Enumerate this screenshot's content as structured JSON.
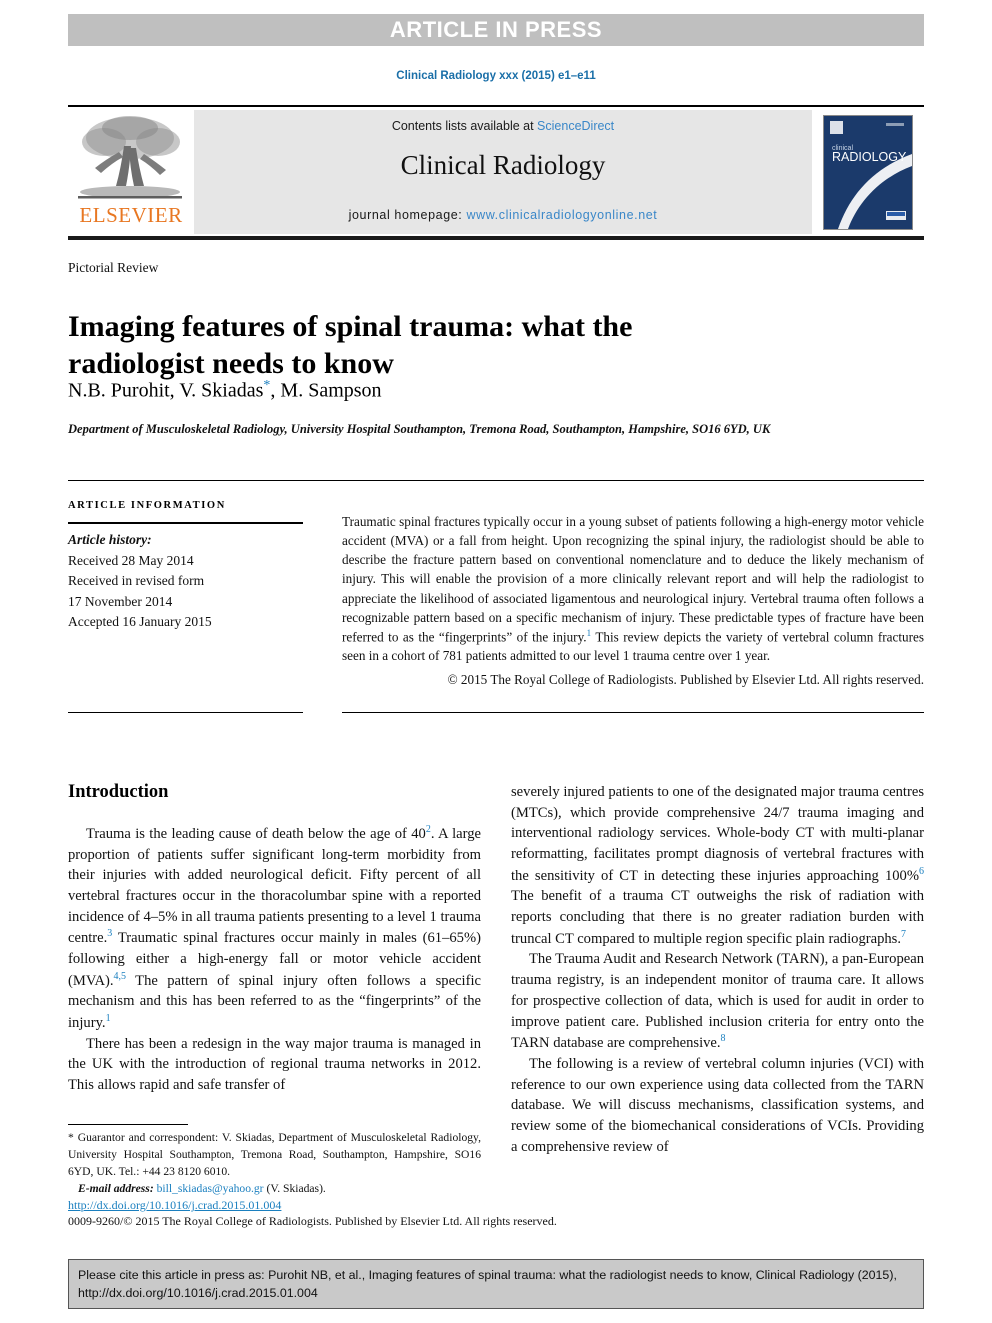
{
  "banner": {
    "text": "ARTICLE IN PRESS"
  },
  "running_head": {
    "text": "Clinical Radiology xxx (2015) e1–e11"
  },
  "masthead": {
    "publisher_logo_label": "ELSEVIER",
    "contents_prefix": "Contents lists available at ",
    "contents_link": "ScienceDirect",
    "journal_name": "Clinical Radiology",
    "homepage_prefix": "journal homepage: ",
    "homepage_link": "www.clinicalradiologyonline.net",
    "cover_line1": "clinical",
    "cover_line2": "RADIOLOGY"
  },
  "article": {
    "type": "Pictorial Review",
    "title": "Imaging features of spinal trauma: what the radiologist needs to know",
    "authors_part1": "N.B. Purohit, V. Skiadas",
    "corresponding_marker": "*",
    "authors_part2": ", M. Sampson",
    "affiliation": "Department of Musculoskeletal Radiology, University Hospital Southampton, Tremona Road, Southampton, Hampshire, SO16 6YD, UK"
  },
  "article_info": {
    "heading": "ARTICLE INFORMATION",
    "history_label": "Article history:",
    "received": "Received 28 May 2014",
    "revised_label": "Received in revised form",
    "revised_date": "17 November 2014",
    "accepted": "Accepted 16 January 2015"
  },
  "abstract": {
    "text": "Traumatic spinal fractures typically occur in a young subset of patients following a high-energy motor vehicle accident (MVA) or a fall from height. Upon recognizing the spinal injury, the radiologist should be able to describe the fracture pattern based on conventional nomenclature and to deduce the likely mechanism of injury. This will enable the provision of a more clinically relevant report and will help the radiologist to appreciate the likelihood of associated ligamentous and neurological injury. Vertebral trauma often follows a recognizable pattern based on a specific mechanism of injury. These predictable types of fracture have been referred to as the “fingerprints” of the injury.",
    "citation_marker": "1",
    "text_after": " This review depicts the variety of vertebral column fractures seen in a cohort of 781 patients admitted to our level 1 trauma centre over 1 year.",
    "copyright": "© 2015 The Royal College of Radiologists. Published by Elsevier Ltd. All rights reserved."
  },
  "body": {
    "section_title": "Introduction",
    "left_paragraphs": [
      {
        "segments": [
          {
            "type": "text",
            "value": "Trauma is the leading cause of death below the age of 40"
          },
          {
            "type": "cite",
            "value": "2"
          },
          {
            "type": "text",
            "value": ". A large proportion of patients suffer significant long-term morbidity from their injuries with added neurological deficit. Fifty percent of all vertebral fractures occur in the thoracolumbar spine with a reported incidence of 4–5% in all trauma patients presenting to a level 1 trauma centre."
          },
          {
            "type": "cite",
            "value": "3"
          },
          {
            "type": "text",
            "value": " Traumatic spinal fractures occur mainly in males (61–65%) following either a high-energy fall or motor vehicle accident (MVA)."
          },
          {
            "type": "cite",
            "value": "4,5"
          },
          {
            "type": "text",
            "value": " The pattern of spinal injury often follows a specific mechanism and this has been referred to as the “fingerprints” of the injury."
          },
          {
            "type": "cite",
            "value": "1"
          }
        ]
      },
      {
        "segments": [
          {
            "type": "text",
            "value": "There has been a redesign in the way major trauma is managed in the UK with the introduction of regional trauma networks in 2012. This allows rapid and safe transfer of"
          }
        ]
      }
    ],
    "right_paragraphs": [
      {
        "segments": [
          {
            "type": "text",
            "value": "severely injured patients to one of the designated major trauma centres (MTCs), which provide comprehensive 24/7 trauma imaging and interventional radiology services. Whole-body CT with multi-planar reformatting, facilitates prompt diagnosis of vertebral fractures with the sensitivity of CT in detecting these injuries approaching 100%"
          },
          {
            "type": "cite",
            "value": "6"
          },
          {
            "type": "text",
            "value": " The benefit of a trauma CT outweighs the risk of radiation with reports concluding that there is no greater radiation burden with truncal CT compared to multiple region specific plain radiographs."
          },
          {
            "type": "cite",
            "value": "7"
          }
        ],
        "no_indent": true
      },
      {
        "segments": [
          {
            "type": "text",
            "value": "The Trauma Audit and Research Network (TARN), a pan-European trauma registry, is an independent monitor of trauma care. It allows for prospective collection of data, which is used for audit in order to improve patient care. Published inclusion criteria for entry onto the TARN database are comprehensive."
          },
          {
            "type": "cite",
            "value": "8"
          }
        ]
      },
      {
        "segments": [
          {
            "type": "text",
            "value": "The following is a review of vertebral column injuries (VCI) with reference to our own experience using data collected from the TARN database. We will discuss mechanisms, classification systems, and review some of the biomechanical considerations of VCIs. Providing a comprehensive review of"
          }
        ]
      }
    ]
  },
  "footnote": {
    "correspondence": "* Guarantor and correspondent: V. Skiadas, Department of Musculoskeletal Radiology, University Hospital Southampton, Tremona Road, Southampton, Hampshire, SO16 6YD, UK. Tel.: +44 23 8120 6010.",
    "email_label": "E-mail address:",
    "email": "bill_skiadas@yahoo.gr",
    "email_suffix": "(V. Skiadas)."
  },
  "footer": {
    "doi": "http://dx.doi.org/10.1016/j.crad.2015.01.004",
    "issn_copyright": "0009-9260/© 2015 The Royal College of Radiologists. Published by Elsevier Ltd. All rights reserved."
  },
  "cite_box": {
    "text": "Please cite this article in press as: Purohit NB, et al., Imaging features of spinal trauma: what the radiologist needs to know, Clinical Radiology (2015), http://dx.doi.org/10.1016/j.crad.2015.01.004"
  },
  "colors": {
    "banner_bg": "#bfbfbf",
    "link_blue": "#1a7fbf",
    "elsevier_orange": "#e87722",
    "masthead_gray": "#e6e6e6",
    "cover_navy": "#1b3a6b",
    "cite_box_bg": "#c9c9c9"
  }
}
